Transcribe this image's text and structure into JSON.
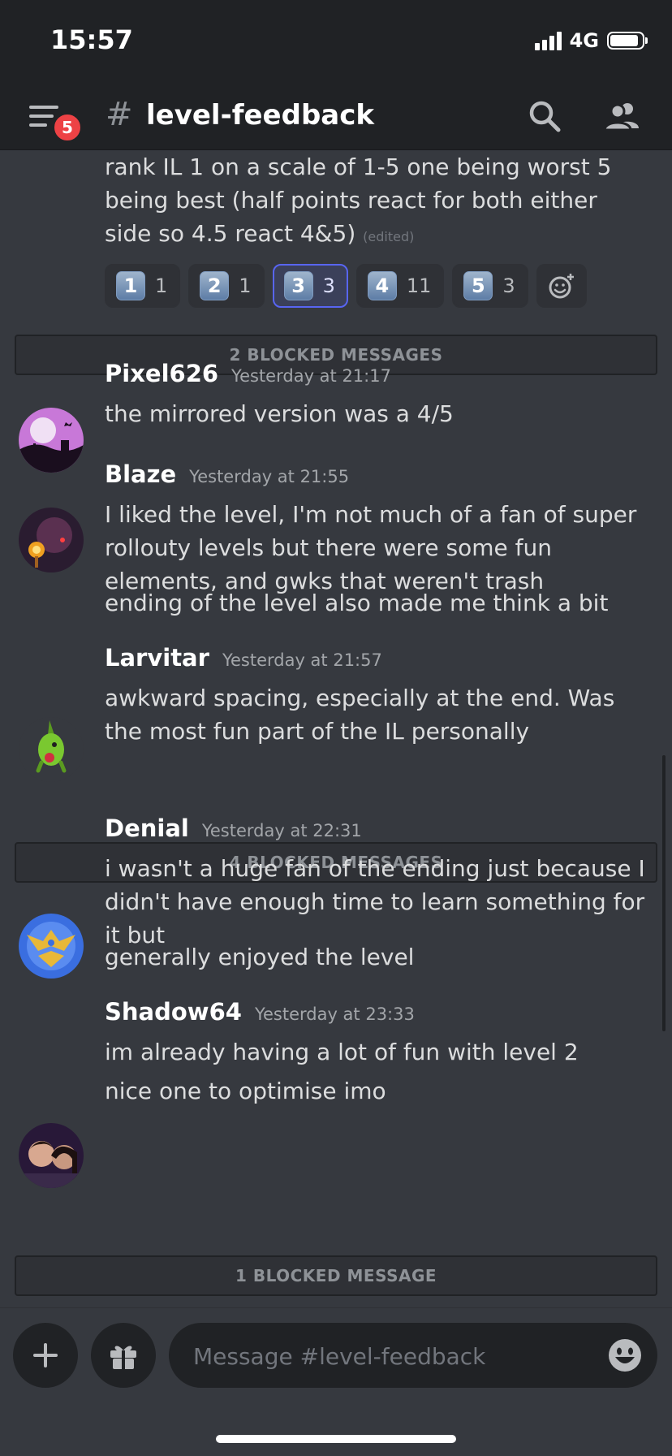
{
  "status_bar": {
    "time": "15:57",
    "network": "4G"
  },
  "header": {
    "hash": "#",
    "channel": "level-feedback",
    "unread_badge": "5"
  },
  "poll_message": {
    "text": "rank IL 1 on a scale of 1-5 one being worst 5 being best (half points react for both either side so 4.5 react 4&5)",
    "edited": "(edited)",
    "reactions": [
      {
        "emoji": "1",
        "count": "1",
        "active": false
      },
      {
        "emoji": "2",
        "count": "1",
        "active": false
      },
      {
        "emoji": "3",
        "count": "3",
        "active": true
      },
      {
        "emoji": "4",
        "count": "11",
        "active": false
      },
      {
        "emoji": "5",
        "count": "3",
        "active": false
      }
    ],
    "add_reaction_icon": "add-reaction-icon"
  },
  "blocked": {
    "first": "2 BLOCKED MESSAGES",
    "second": "4 BLOCKED MESSAGES",
    "third": "1 BLOCKED MESSAGE"
  },
  "messages": [
    {
      "author": "Pixel626",
      "timestamp": "Yesterday at 21:17",
      "lines": [
        "the mirrored version was a 4/5"
      ]
    },
    {
      "author": "Blaze",
      "timestamp": "Yesterday at 21:55",
      "lines": [
        "I liked the level, I'm not much of a fan of super rollouty levels but there were some fun elements, and gwks that weren't trash",
        "ending of the level also made me think a bit"
      ]
    },
    {
      "author": "Larvitar",
      "timestamp": "Yesterday at 21:57",
      "lines": [
        "awkward spacing, especially at the end. Was the most fun part of the IL personally"
      ]
    },
    {
      "author": "Denial",
      "timestamp": "Yesterday at 22:31",
      "lines": [
        "i wasn't a huge fan of the ending just because I didn't have enough time to learn something for it but",
        "generally enjoyed the level"
      ]
    },
    {
      "author": "Shadow64",
      "timestamp": "Yesterday at 23:33",
      "lines": [
        "im already having a lot of fun with level 2",
        "nice one to optimise imo"
      ]
    }
  ],
  "composer": {
    "placeholder": "Message #level-feedback"
  },
  "colors": {
    "background": "#36393f",
    "header": "#202225",
    "accent": "#5865f2",
    "badge": "#ed4245"
  }
}
